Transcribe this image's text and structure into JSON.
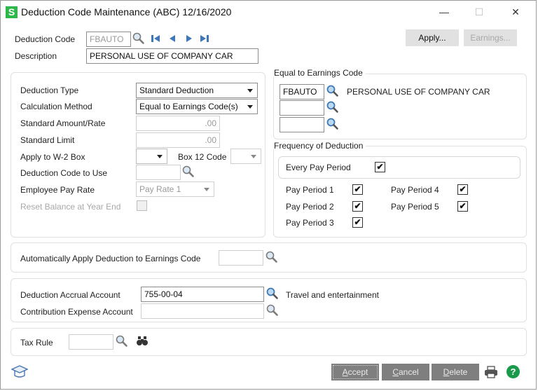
{
  "window": {
    "app_icon_letter": "S",
    "title": "Deduction Code Maintenance (ABC) 12/16/2020",
    "controls": {
      "minimize": "—",
      "maximize": "☐",
      "close": "✕"
    }
  },
  "header": {
    "deduction_code_label": "Deduction Code",
    "deduction_code_value": "FBAUTO",
    "description_label": "Description",
    "description_value": "PERSONAL USE OF COMPANY CAR",
    "apply_button": "Apply...",
    "earnings_button": "Earnings..."
  },
  "settings": {
    "deduction_type_label": "Deduction Type",
    "deduction_type_value": "Standard Deduction",
    "calculation_method_label": "Calculation Method",
    "calculation_method_value": "Equal to Earnings Code(s)",
    "standard_amount_label": "Standard Amount/Rate",
    "standard_amount_value": ".00",
    "standard_limit_label": "Standard Limit",
    "standard_limit_value": ".00",
    "apply_w2_label": "Apply to W-2 Box",
    "apply_w2_value": "",
    "box12_label": "Box 12 Code",
    "box12_value": "",
    "deduction_code_to_use_label": "Deduction Code to Use",
    "deduction_code_to_use_value": "",
    "employee_pay_rate_label": "Employee Pay Rate",
    "employee_pay_rate_value": "Pay Rate 1",
    "reset_balance_label": "Reset Balance at Year End",
    "reset_balance_checked": false
  },
  "equal_to_earnings": {
    "title": "Equal to Earnings Code",
    "rows": [
      {
        "code": "FBAUTO",
        "description": "PERSONAL USE OF COMPANY CAR"
      },
      {
        "code": "",
        "description": ""
      },
      {
        "code": "",
        "description": ""
      }
    ]
  },
  "frequency": {
    "title": "Frequency of Deduction",
    "every_pay_period_label": "Every Pay Period",
    "every_pay_period_checked": true,
    "periods": [
      {
        "label": "Pay Period 1",
        "checked": true
      },
      {
        "label": "Pay Period 2",
        "checked": true
      },
      {
        "label": "Pay Period 3",
        "checked": true
      },
      {
        "label": "Pay Period 4",
        "checked": true
      },
      {
        "label": "Pay Period 5",
        "checked": true
      }
    ],
    "check_glyph": "✔"
  },
  "auto_apply": {
    "label": "Automatically Apply Deduction to Earnings Code",
    "value": ""
  },
  "accounts": {
    "accrual_label": "Deduction Accrual Account",
    "accrual_value": "755-00-04",
    "accrual_description": "Travel and entertainment",
    "contribution_label": "Contribution Expense Account",
    "contribution_value": ""
  },
  "tax": {
    "label": "Tax Rule",
    "value": ""
  },
  "footer": {
    "accept_prefix": "A",
    "accept_rest": "ccept",
    "cancel_prefix": "C",
    "cancel_rest": "ancel",
    "delete_prefix": "D",
    "delete_rest": "elete",
    "help_glyph": "?"
  },
  "colors": {
    "app_icon": "#2db84a",
    "nav_arrows": "#3f78b8",
    "help": "#1a9a4a",
    "footer_buttons": "#7f7f7f"
  },
  "icons": {
    "lookup": "magnifier-icon",
    "nav_first": "first-record-icon",
    "nav_prev": "previous-record-icon",
    "nav_next": "next-record-icon",
    "nav_last": "last-record-icon",
    "binoculars": "binoculars-icon",
    "training": "graduation-cap-icon",
    "print": "printer-icon",
    "help": "help-icon"
  }
}
